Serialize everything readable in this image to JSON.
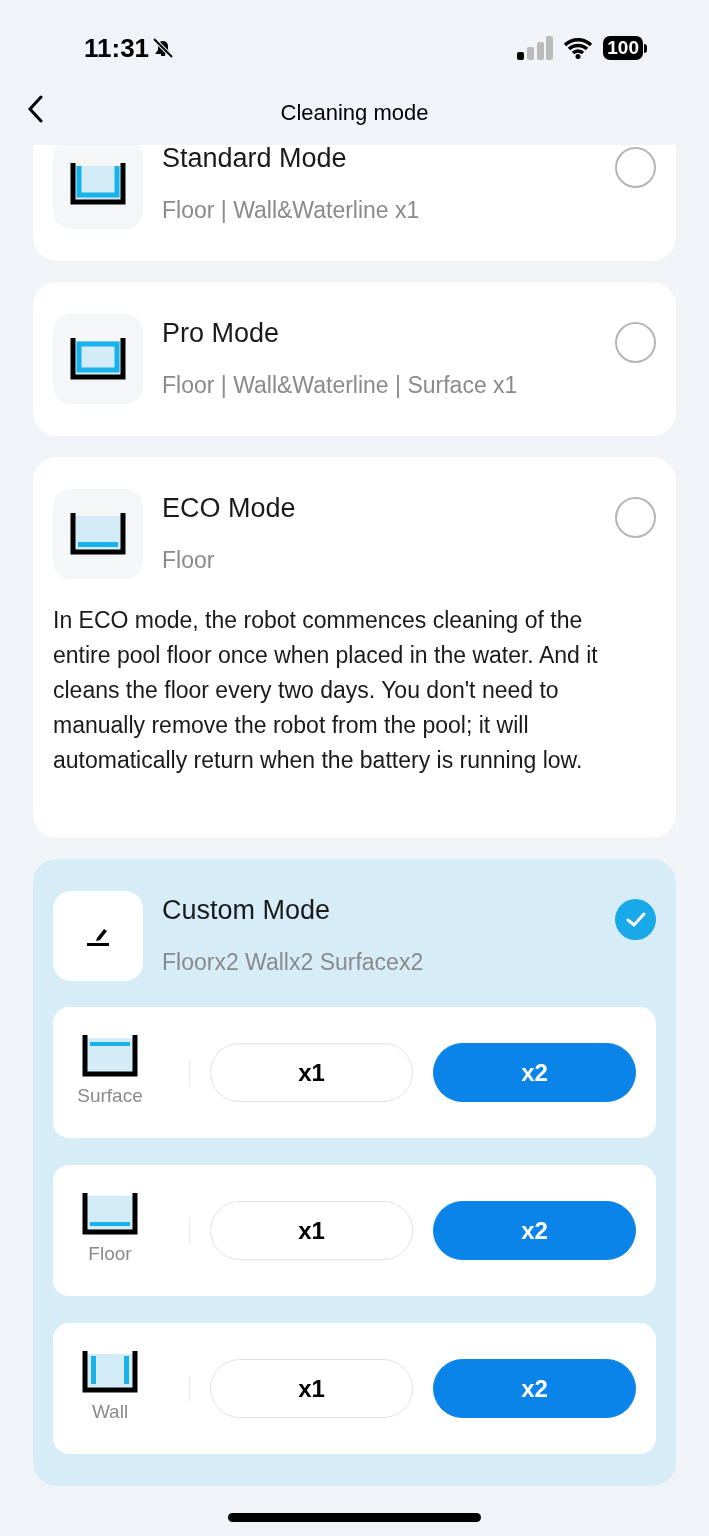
{
  "status_bar": {
    "time": "11:31",
    "battery": "100"
  },
  "header": {
    "title": "Cleaning mode"
  },
  "modes": [
    {
      "kind": "standard",
      "title": "Standard Mode",
      "subtitle": "Floor | Wall&Waterline x1",
      "selected": false
    },
    {
      "kind": "pro",
      "title": "Pro Mode",
      "subtitle": "Floor | Wall&Waterline | Surface x1",
      "selected": false
    },
    {
      "kind": "eco",
      "title": "ECO Mode",
      "subtitle": "Floor",
      "selected": false,
      "description": "In ECO mode, the robot commences cleaning of the entire pool floor once when placed in the water. And it cleans the floor every two days. You don't need to manually remove the robot from the pool; it will automatically return when the battery is running low."
    },
    {
      "kind": "custom",
      "title": "Custom Mode",
      "subtitle": "Floorx2 Wallx2 Surfacex2",
      "selected": true,
      "options": [
        {
          "kind": "surface",
          "label": "Surface",
          "choices": [
            {
              "label": "x1",
              "selected": false
            },
            {
              "label": "x2",
              "selected": true
            }
          ]
        },
        {
          "kind": "floor",
          "label": "Floor",
          "choices": [
            {
              "label": "x1",
              "selected": false
            },
            {
              "label": "x2",
              "selected": true
            }
          ]
        },
        {
          "kind": "wall",
          "label": "Wall",
          "choices": [
            {
              "label": "x1",
              "selected": false
            },
            {
              "label": "x2",
              "selected": true
            }
          ]
        }
      ]
    }
  ]
}
